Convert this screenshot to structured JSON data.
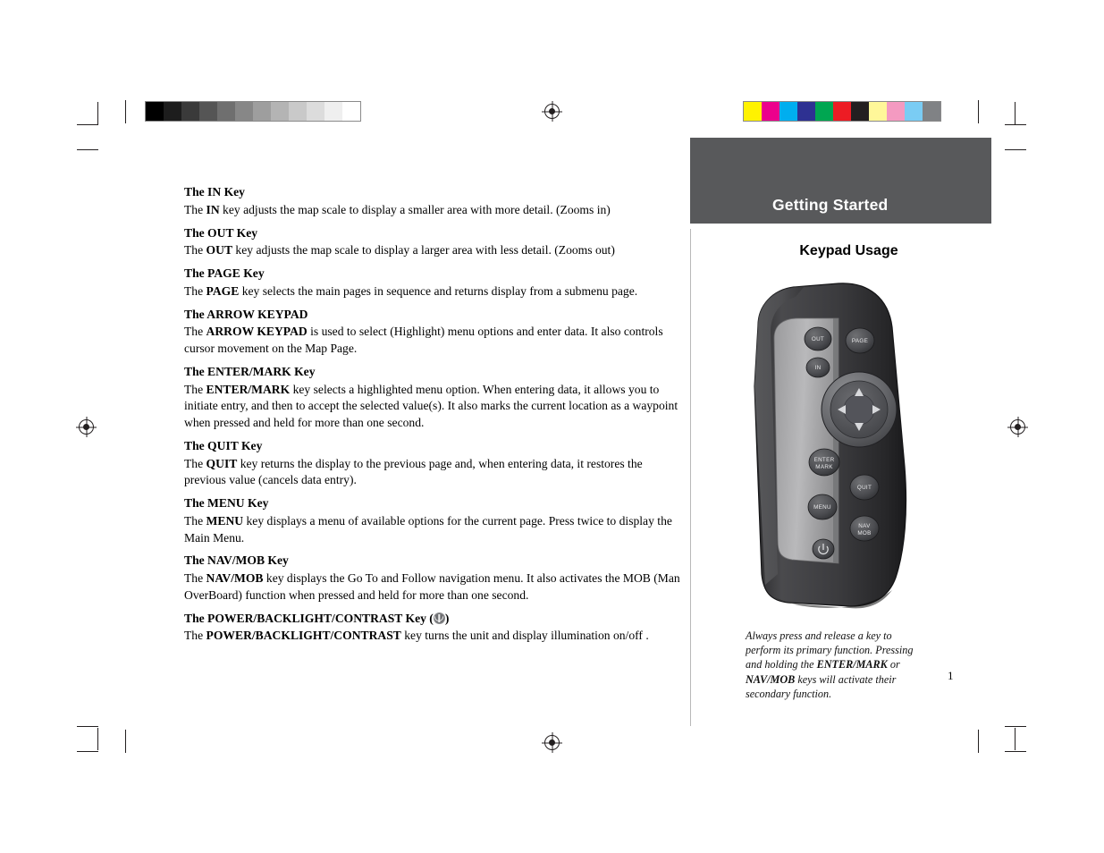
{
  "document": {
    "chapter": "Getting Started",
    "section": "Keypad Usage",
    "page_number": "1"
  },
  "keys": [
    {
      "head": "The IN Key",
      "body_pre": "The ",
      "body_bold": "IN",
      "body_post": " key adjusts the map scale to display a smaller area with more detail. (Zooms in)"
    },
    {
      "head": "The OUT Key",
      "body_pre": "The ",
      "body_bold": "OUT",
      "body_post": " key adjusts the map scale to display a larger area with less detail. (Zooms out)"
    },
    {
      "head": "The PAGE Key",
      "body_pre": "The ",
      "body_bold": "PAGE",
      "body_post": " key selects the main pages in sequence and returns display from a submenu page."
    },
    {
      "head": "The ARROW KEYPAD",
      "body_pre": "The ",
      "body_bold": "ARROW KEYPAD",
      "body_post": " is used to select (Highlight) menu options and enter data.  It also controls cursor movement on the Map Page."
    },
    {
      "head": "The ENTER/MARK Key",
      "body_pre": "The ",
      "body_bold": "ENTER/MARK",
      "body_post": " key selects a highlighted menu option.  When entering data, it allows you to initiate entry, and then to accept the selected value(s).  It also marks the current location as a waypoint when pressed and held for more than one second."
    },
    {
      "head": "The QUIT Key",
      "body_pre": "The ",
      "body_bold": "QUIT",
      "body_post": " key returns the display to the previous page and, when entering data, it restores the previous value (cancels data entry)."
    },
    {
      "head": "The MENU Key",
      "body_pre": "The ",
      "body_bold": "MENU",
      "body_post": " key displays a menu of available options for the current page.  Press twice to display the Main Menu."
    },
    {
      "head": "The NAV/MOB Key",
      "body_pre": "The ",
      "body_bold": "NAV/MOB",
      "body_post": " key displays the Go To and Follow navigation menu.  It also activates the MOB (Man OverBoard) function when pressed and held for more than one second."
    },
    {
      "head": "The POWER/BACKLIGHT/CONTRAST Key (",
      "head_post": ")",
      "body_pre": "The ",
      "body_bold": "POWER/BACKLIGHT/CONTRAST",
      "body_post": " key turns the unit and display illumination on/off ."
    }
  ],
  "caption": {
    "line1": "Always press and release a key to perform",
    "line2": "its primary function.  Pressing and holding",
    "line3_pre": "the ",
    "line3_bold1": "ENTER/MARK",
    "line3_mid": " or ",
    "line3_bold2": "NAV/MOB",
    "line3_post": " keys",
    "line4": "will activate their secondary function."
  },
  "device_keys": {
    "out": "OUT",
    "in": "IN",
    "page": "PAGE",
    "enter": "ENTER",
    "mark": "MARK",
    "quit": "QUIT",
    "menu": "MENU",
    "nav": "NAV",
    "mob": "MOB"
  },
  "calibration": {
    "grayscale": [
      "#000000",
      "#1d1d1d",
      "#3a3a3a",
      "#555555",
      "#6f6f6f",
      "#878787",
      "#9e9e9e",
      "#b4b4b4",
      "#c9c9c9",
      "#dcdcdc",
      "#efefef",
      "#ffffff"
    ],
    "color": [
      "#fff200",
      "#ec008c",
      "#00aeef",
      "#2e3192",
      "#00a651",
      "#ed1c24",
      "#231f20",
      "#fff799",
      "#f49ac1",
      "#7accf4",
      "#808285"
    ]
  }
}
